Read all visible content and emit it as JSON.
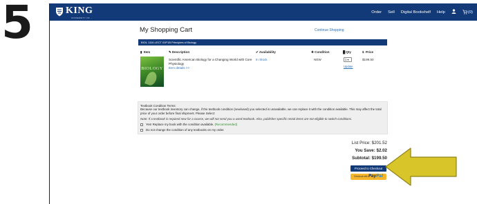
{
  "step_number": "5",
  "navbar": {
    "logo": "KING",
    "logo_subtext": "UNIVERSITY OF ...",
    "links": [
      "Order",
      "Sell",
      "Digital Bookshelf",
      "Help"
    ],
    "cart_count": "(0)"
  },
  "page": {
    "title": "My Shopping Cart",
    "continue_label": "Continue Shopping"
  },
  "course": {
    "label": "BIOL   1110-LECT   01P1B   Principles of Biology"
  },
  "table": {
    "headers": {
      "item": "Item",
      "description": "Description",
      "availability": "Availability",
      "condition": "Condition",
      "qty": "Qty",
      "price": "Price"
    },
    "row": {
      "cover_title": "BIOLOGY",
      "title": "Scientific American Biology for a Changing World with Core Physiology",
      "details_link": "Item details >>",
      "availability": "In Stock",
      "condition": "NEW",
      "qty": "1",
      "update_label": "Update",
      "price": "$199.50"
    }
  },
  "terms": {
    "heading": "Textbook Condition Terms:",
    "body": "Because our textbook inventory can change, if the textbook condition (new/used) you selected is unavailable, we can replace it with the condition available. This may affect the total price of your order before final shipment. Please Select:",
    "note": "Note: If a textbook is required new for a course, we will not send you a used textbook. Also, publisher specific rental items are not eligible to switch conditions.",
    "option_1": "Yes! Replace my book with the condition available.",
    "option_1_tag": "(Recommended)",
    "option_2": "Do not change the condition of any textbooks on my order."
  },
  "totals": {
    "list_price": "List Price: $201.52",
    "you_save": "You Save: $2.02",
    "subtotal": "Subtotal: $199.50"
  },
  "buttons": {
    "checkout": "Proceed to Checkout",
    "paypal_prefix": "Checkout with",
    "paypal_pay": "Pay",
    "paypal_pal": "Pal"
  },
  "colors": {
    "navbar": "#123a78",
    "link": "#2a6fb6",
    "arrow": "#d8c52a",
    "paypal": "#f5b62b"
  }
}
